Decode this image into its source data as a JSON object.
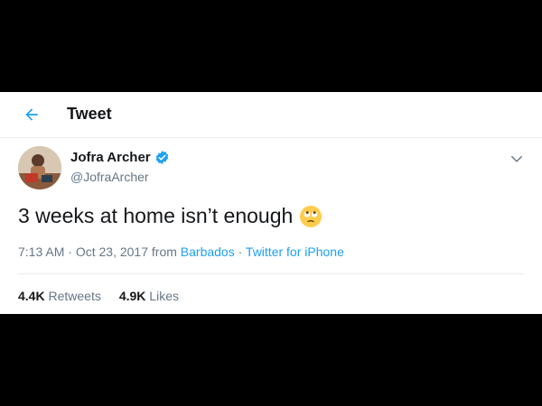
{
  "header": {
    "title": "Tweet",
    "back_icon": "arrow-left-icon"
  },
  "author": {
    "display_name": "Jofra Archer",
    "handle": "@JofraArcher",
    "verified_icon": "verified-badge-icon"
  },
  "tweet": {
    "text": "3 weeks at home isn’t enough",
    "emoji": "face-with-rolling-eyes"
  },
  "meta": {
    "time": "7:13 AM",
    "separator1": " · ",
    "date": "Oct 23, 2017",
    "from_label": " from ",
    "location": "Barbados",
    "separator2": " · ",
    "source": "Twitter for iPhone"
  },
  "stats": {
    "retweets_count": "4.4K",
    "retweets_label": "Retweets",
    "likes_count": "4.9K",
    "likes_label": "Likes"
  },
  "colors": {
    "accent": "#1da1f2",
    "text": "#14171a",
    "secondary": "#657786",
    "border": "#e6ecf0",
    "background_outside": "#000000"
  }
}
